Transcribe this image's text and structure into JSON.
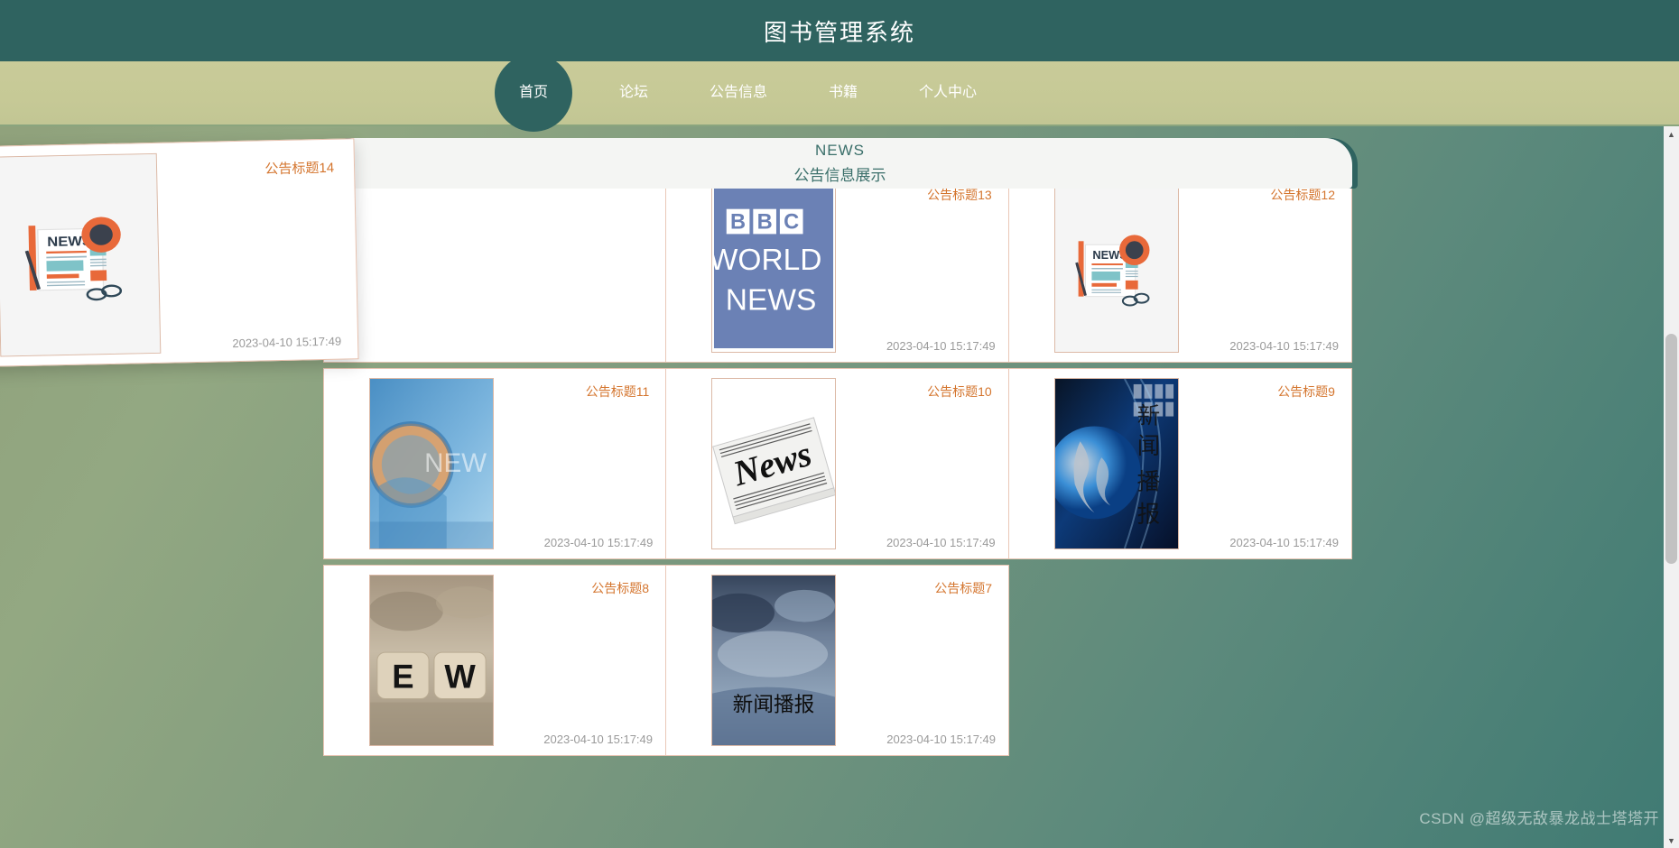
{
  "header": {
    "title": "图书管理系统",
    "bg_color": "#2f6360"
  },
  "nav": {
    "bg_color": "#c6c996",
    "active_color": "#2f6360",
    "items": [
      {
        "label": "首页",
        "active": true
      },
      {
        "label": "论坛",
        "active": false
      },
      {
        "label": "公告信息",
        "active": false
      },
      {
        "label": "书籍",
        "active": false
      },
      {
        "label": "个人中心",
        "active": false
      }
    ]
  },
  "banner": {
    "line1": "NEWS",
    "line2": "公告信息展示",
    "text_color": "#3a6f6a"
  },
  "announcements": {
    "title_color": "#d4752e",
    "date_color": "#9a9a9a",
    "items": [
      {
        "title": "公告标题14",
        "date": "2023-04-10 15:17:49",
        "image": "news-flat-illustration",
        "featured": true
      },
      {
        "title": "公告标题13",
        "date": "2023-04-10 15:17:49",
        "image": "bbc-world-news-logo",
        "featured": false
      },
      {
        "title": "公告标题12",
        "date": "2023-04-10 15:17:49",
        "image": "news-flat-illustration",
        "featured": false
      },
      {
        "title": "公告标题11",
        "date": "2023-04-10 15:17:49",
        "image": "blue-globe-news-studio",
        "featured": false
      },
      {
        "title": "公告标题10",
        "date": "2023-04-10 15:17:49",
        "image": "folded-newspaper-news",
        "featured": false
      },
      {
        "title": "公告标题9",
        "date": "2023-04-10 15:17:49",
        "image": "blue-globe-broadcast",
        "featured": false
      },
      {
        "title": "公告标题8",
        "date": "2023-04-10 15:17:49",
        "image": "wooden-dice-ew",
        "featured": false
      },
      {
        "title": "公告标题7",
        "date": "2023-04-10 15:17:49",
        "image": "cloudy-sky-broadcast",
        "featured": false
      }
    ],
    "image_texts": {
      "bbc_line1": "BBC",
      "bbc_line2": "WORLD",
      "bbc_line3": "NEWS",
      "news_headline": "NEWS",
      "newspaper_word": "News",
      "broadcast_cn": "新闻播报",
      "dice_left": "E",
      "dice_right": "W",
      "studio_news": "NEW"
    }
  },
  "scrollbar": {
    "up_arrow": "▲",
    "down_arrow": "▼"
  },
  "watermark": {
    "text": "CSDN @超级无敌暴龙战士塔塔开"
  }
}
